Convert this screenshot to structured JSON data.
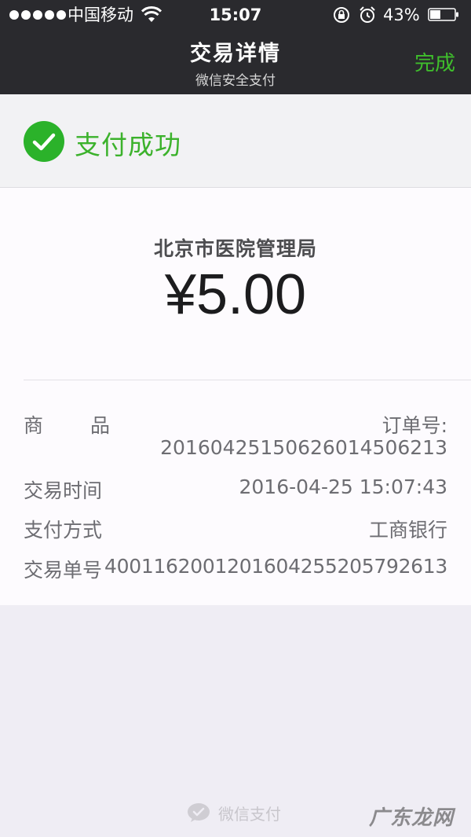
{
  "status_bar": {
    "carrier": "中国移动",
    "time": "15:07",
    "battery_percent": "43%",
    "battery_level": 0.43
  },
  "nav": {
    "title": "交易详情",
    "subtitle": "微信安全支付",
    "done_label": "完成",
    "done_color": "#3fbf2c"
  },
  "result": {
    "status_text": "支付成功",
    "status_color": "#3cb22c",
    "icon": "check-circle-icon"
  },
  "payment": {
    "merchant": "北京市医院管理局",
    "amount": "¥5.00"
  },
  "details": {
    "goods_label_chars": [
      "商",
      "品"
    ],
    "order_label": "订单号:",
    "order_number": "20160425150626014506213",
    "time_label": "交易时间",
    "time_value": "2016-04-25 15:07:43",
    "method_label": "支付方式",
    "method_value": "工商银行",
    "trade_label": "交易单号",
    "trade_value": "4001162001201604255205792613"
  },
  "footer": {
    "brand": "微信支付",
    "icon": "wechat-pay-icon",
    "watermark": "广东龙网"
  }
}
